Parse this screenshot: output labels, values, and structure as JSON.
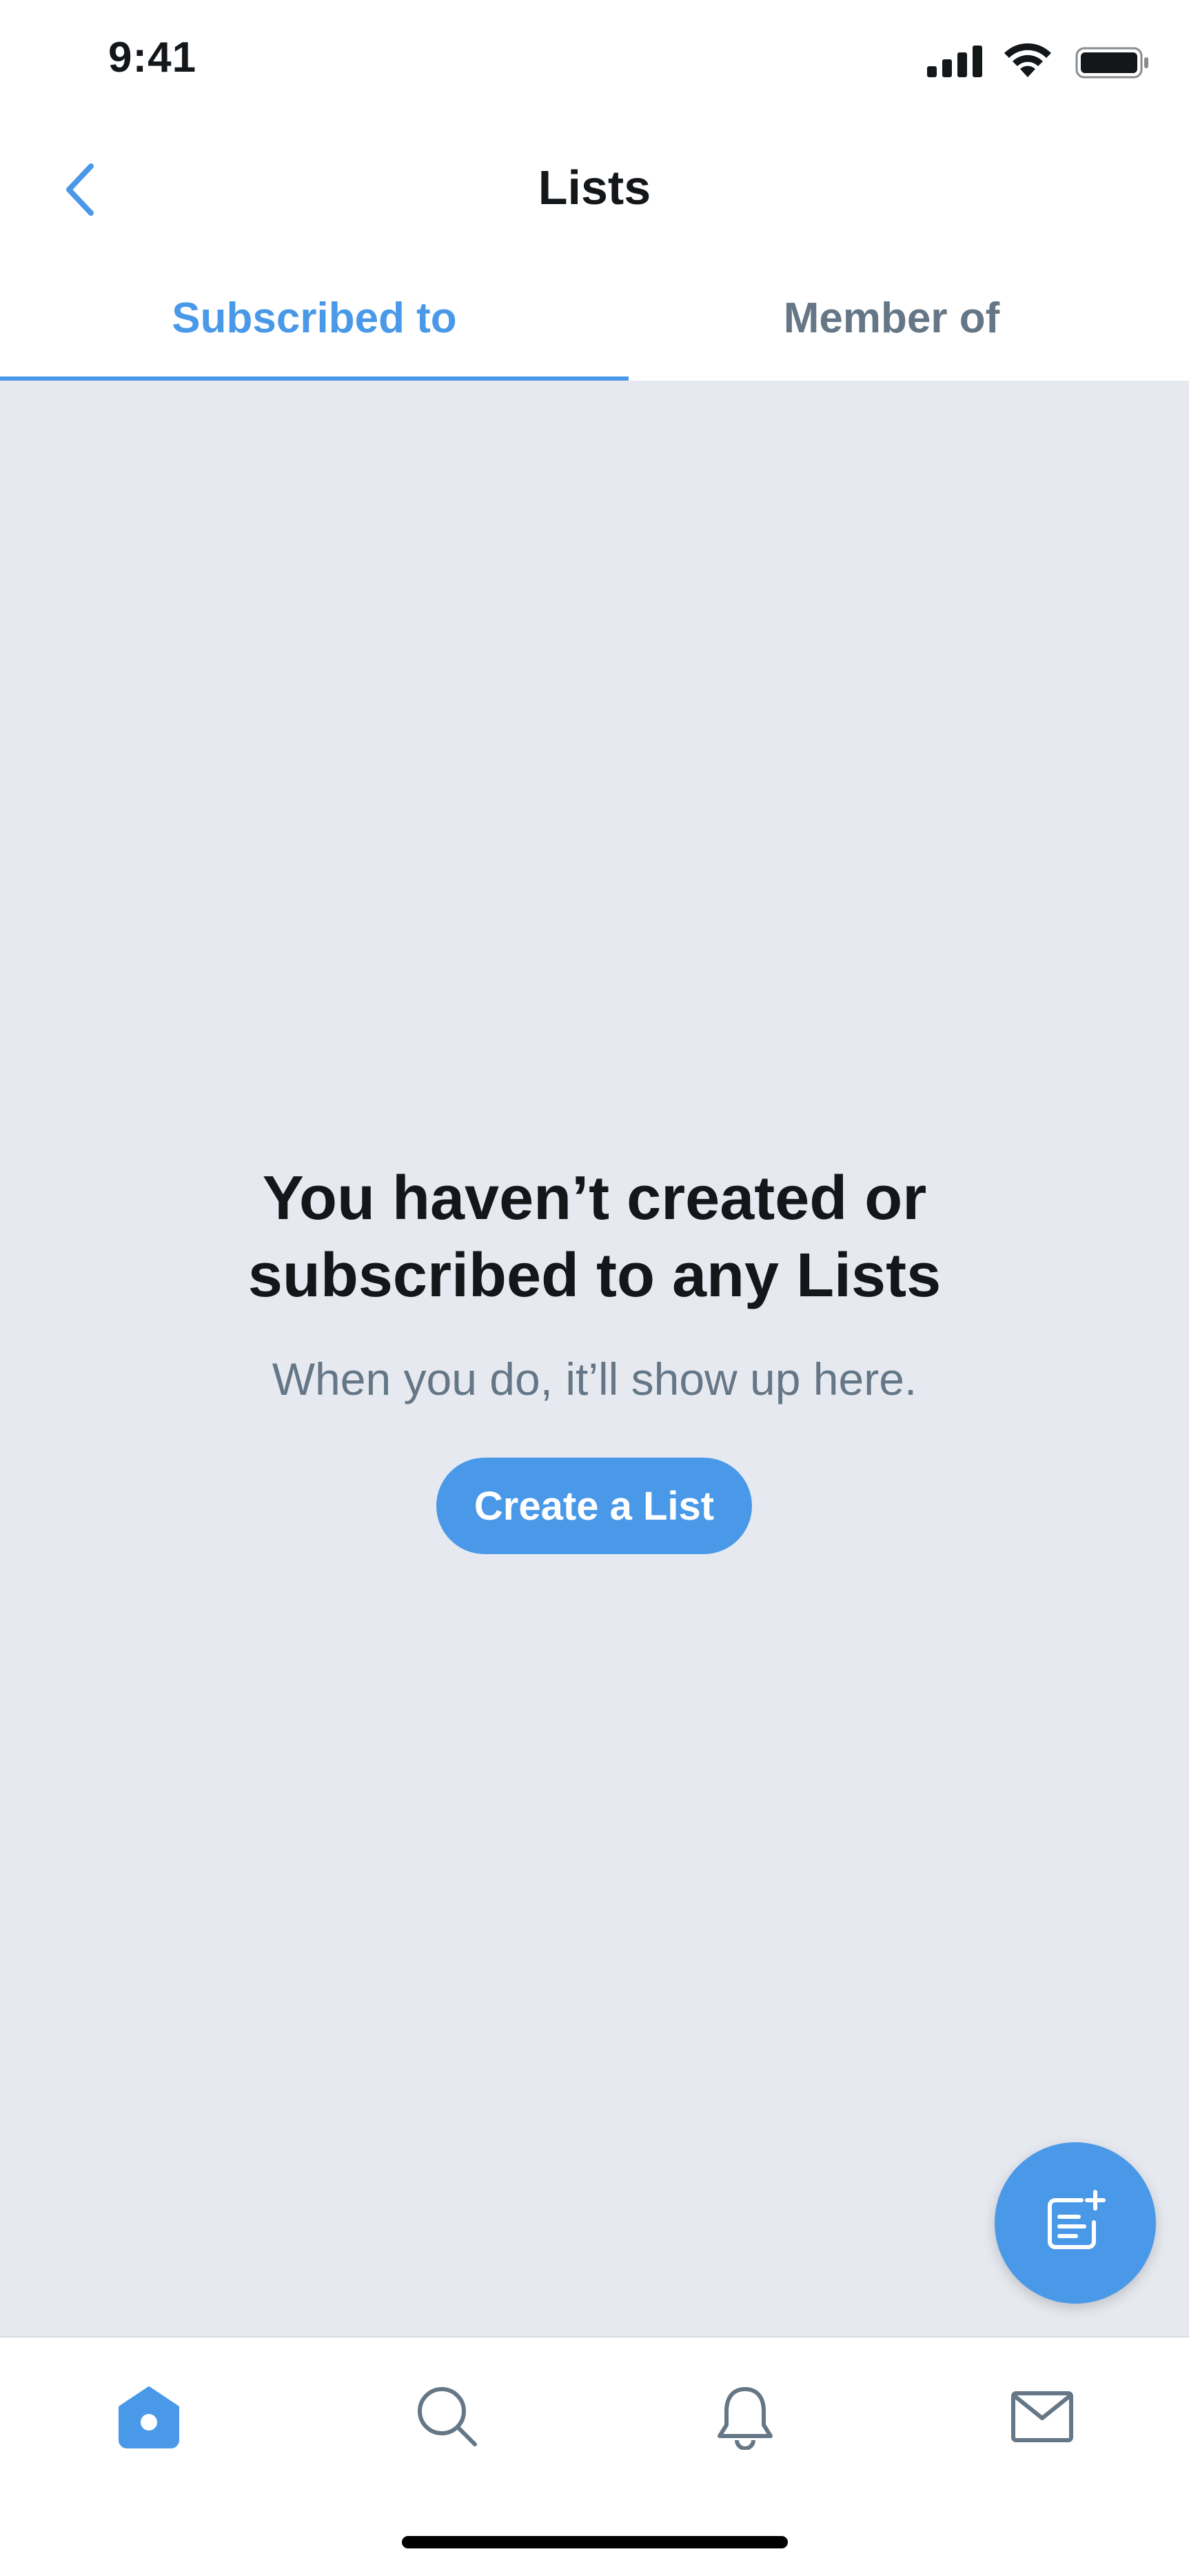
{
  "status_bar": {
    "time": "9:41",
    "icons": [
      "signal-icon",
      "wifi-icon",
      "battery-icon"
    ]
  },
  "nav": {
    "title": "Lists",
    "back_icon": "chevron-left-icon"
  },
  "tabs": [
    {
      "label": "Subscribed to",
      "active": true
    },
    {
      "label": "Member of",
      "active": false
    }
  ],
  "empty_state": {
    "title_line1": "You haven’t created or",
    "title_line2": "subscribed to any Lists",
    "subtitle": "When you do, it’ll show up here.",
    "button_label": "Create a List"
  },
  "fab": {
    "icon": "new-list-icon"
  },
  "tab_bar": {
    "items": [
      {
        "icon": "home-icon",
        "active": true
      },
      {
        "icon": "search-icon",
        "active": false
      },
      {
        "icon": "notifications-icon",
        "active": false
      },
      {
        "icon": "messages-icon",
        "active": false
      }
    ]
  },
  "colors": {
    "accent": "#4a99e9",
    "background": "#e6eaf0",
    "text_primary": "#14171a",
    "text_secondary": "#657786"
  }
}
